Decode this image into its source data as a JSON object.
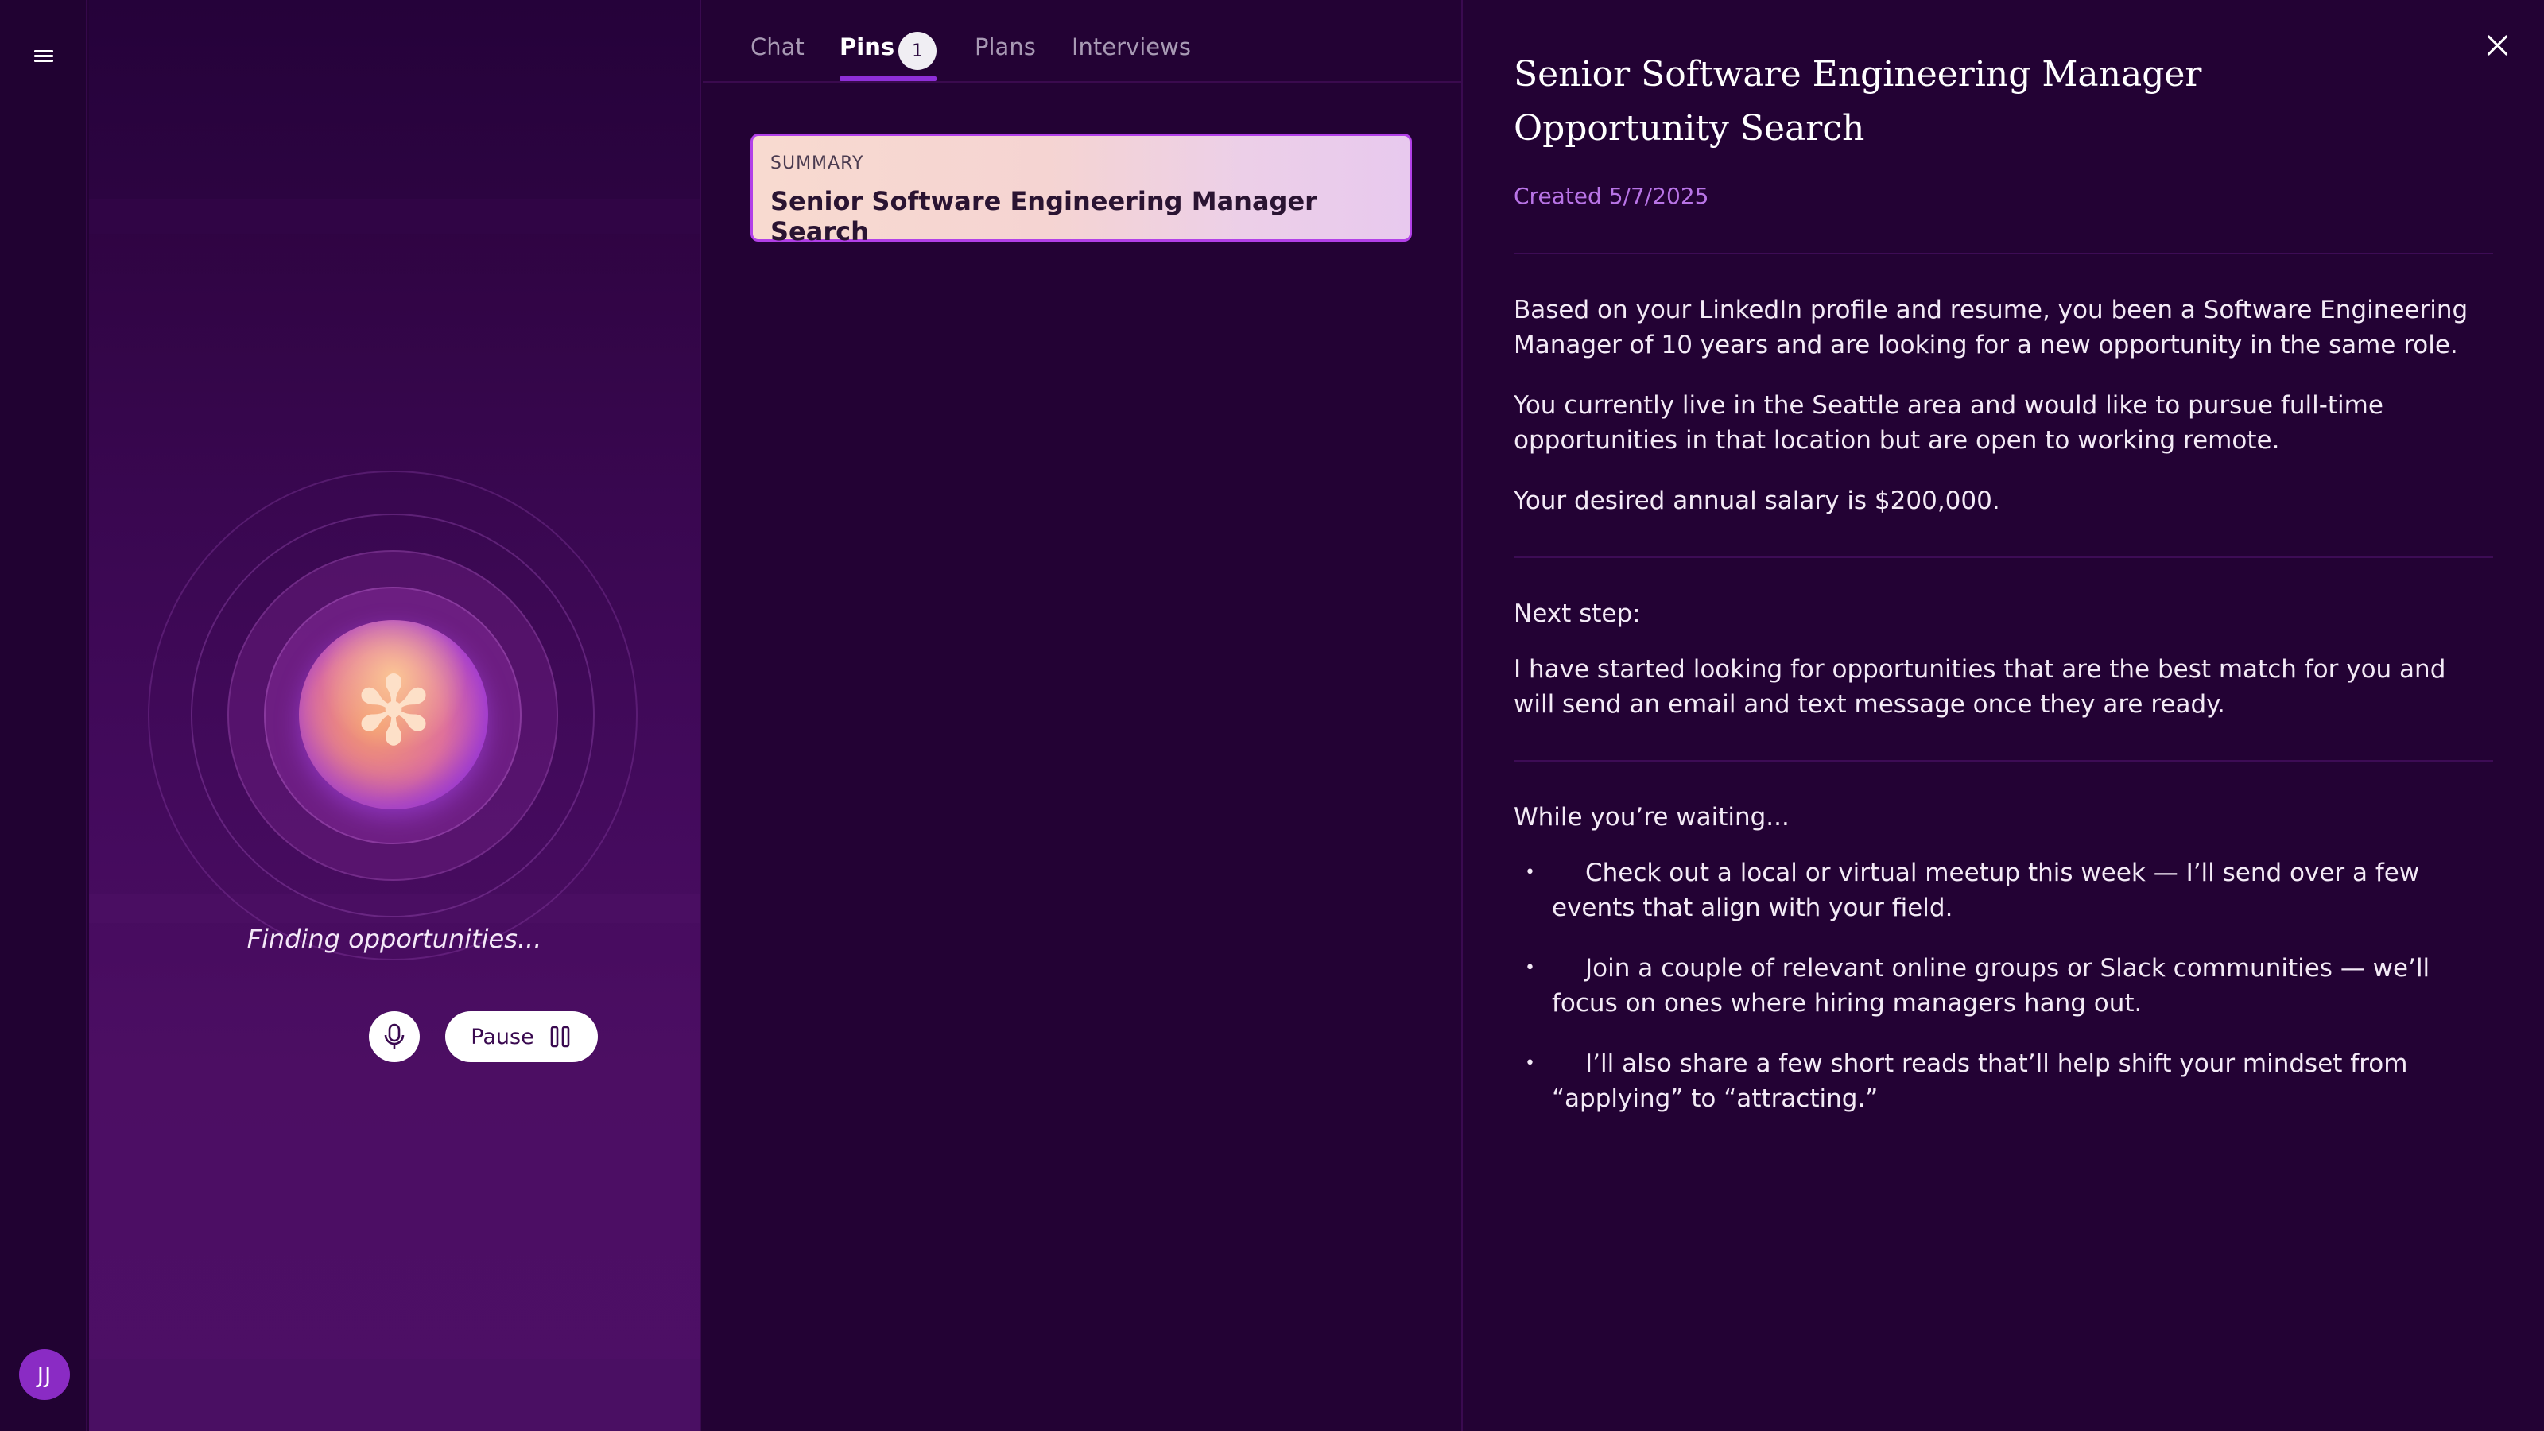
{
  "rail": {
    "menu_icon": "hamburger-menu-icon",
    "avatar_initials": "JJ"
  },
  "agent": {
    "status": "Finding opportunities...",
    "mic_icon": "microphone-icon",
    "pause_label": "Pause",
    "pause_icon": "pause-icon"
  },
  "tabs": {
    "chat": "Chat",
    "pins": "Pins",
    "pins_count": "1",
    "plans": "Plans",
    "interviews": "Interviews",
    "active": "Pins"
  },
  "pins": [
    {
      "kicker": "SUMMARY",
      "title": "Senior Software Engineering Manager Search"
    }
  ],
  "detail": {
    "title": "Senior Software Engineering Manager Opportunity Search",
    "created": "Created 5/7/2025",
    "summary_paragraphs": [
      "Based on your LinkedIn profile and resume, you been a Software Engineering Manager of 10 years and are looking for a new opportunity in the same role.",
      "You currently live in the Seattle area and would like to pursue full-time opportunities in that location but are open to working remote.",
      "Your desired annual salary is $200,000."
    ],
    "next_step_heading": "Next step:",
    "next_step_text": "I have started looking for opportunities that are the best match for you and will send an email and text message once they are ready.",
    "waiting_heading": "While you’re waiting...",
    "waiting_items": [
      "Check out a local or virtual meetup this week — I’ll send over a few events that align with your field.",
      "Join a couple of relevant online groups or Slack communities — we’ll focus on ones where hiring managers hang out.",
      "I’ll also share a few short reads that’ll help shift your mindset from “applying” to “attracting.”"
    ]
  },
  "colors": {
    "background": "#230234",
    "accent": "#8e2fd8",
    "created_text": "#b874e6",
    "avatar": "#8a2bc4"
  }
}
